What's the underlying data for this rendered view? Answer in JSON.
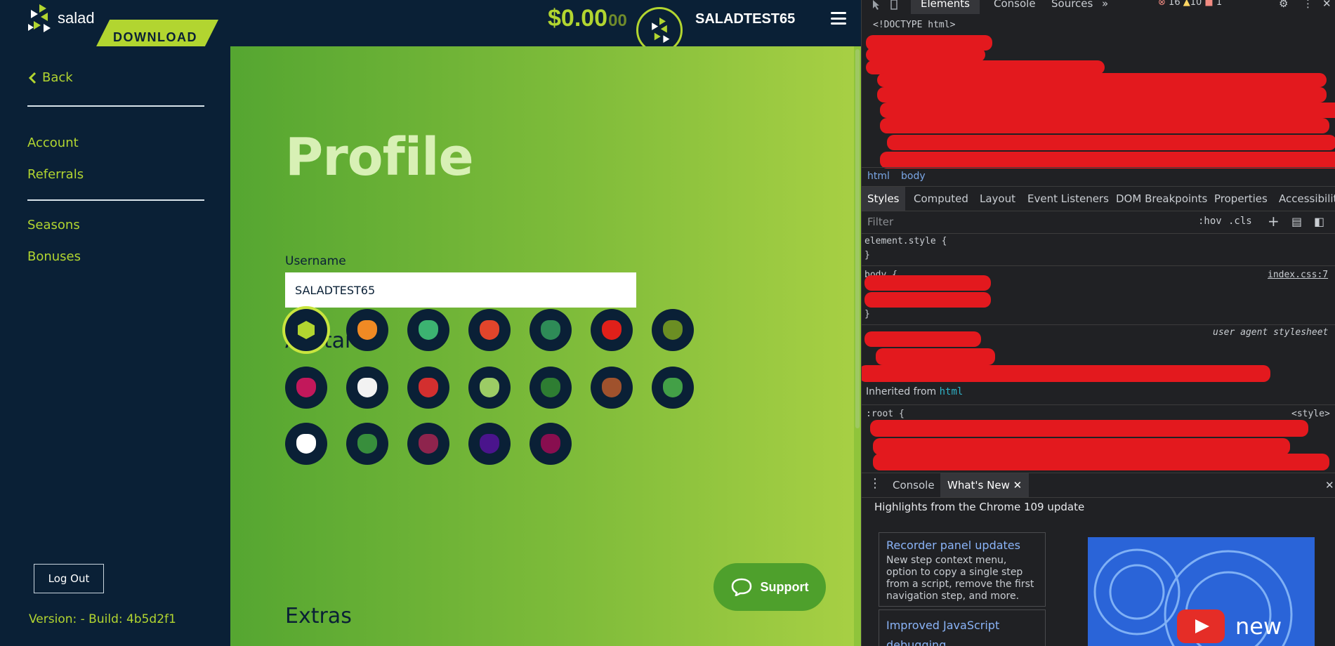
{
  "app": {
    "logo_text": "salad",
    "download_label": "DOWNLOAD",
    "balance_main": "$0.00",
    "balance_cents": "00",
    "username": "SALADTEST65"
  },
  "sidebar": {
    "back_label": "Back",
    "items": [
      {
        "label": "Account"
      },
      {
        "label": "Referrals"
      },
      {
        "label": "Seasons"
      },
      {
        "label": "Bonuses"
      }
    ],
    "logout_label": "Log Out",
    "version": "Version: - Build: 4b5d2f1"
  },
  "main": {
    "title": "Profile",
    "username_label": "Username",
    "username_value": "SALADTEST65",
    "avatar_title": "Avatar",
    "extras_title": "Extras",
    "support_label": "Support",
    "avatars": [
      {
        "name": "salad-logo",
        "selected": true
      },
      {
        "name": "carrot"
      },
      {
        "name": "green-pepper"
      },
      {
        "name": "tomato"
      },
      {
        "name": "kale"
      },
      {
        "name": "red-bell-pepper"
      },
      {
        "name": "avocado"
      },
      {
        "name": "radish"
      },
      {
        "name": "cauliflower"
      },
      {
        "name": "strawberry"
      },
      {
        "name": "lettuce"
      },
      {
        "name": "cucumbers"
      },
      {
        "name": "mushrooms"
      },
      {
        "name": "broccoli"
      },
      {
        "name": "eggs"
      },
      {
        "name": "herbs"
      },
      {
        "name": "beet"
      },
      {
        "name": "eggplant"
      },
      {
        "name": "onion"
      }
    ]
  },
  "devtools": {
    "tabs": [
      "Elements",
      "Console",
      "Sources"
    ],
    "errors": "16",
    "warnings": "10",
    "issues": "1",
    "doctype": "<!DOCTYPE html>",
    "breadcrumbs": [
      "html",
      "body"
    ],
    "style_tabs": [
      "Styles",
      "Computed",
      "Layout",
      "Event Listeners",
      "DOM Breakpoints",
      "Properties",
      "Accessibility"
    ],
    "filter_placeholder": "Filter",
    "hov": ":hov",
    "cls": ".cls",
    "element_style": "element.style {",
    "close_brace": "}",
    "body_rule": "body {",
    "body_source": "index.css:7",
    "ua_label": "user agent stylesheet",
    "inherited_from": "Inherited from",
    "inherited_el": "html",
    "root_rule": ":root {",
    "style_source": "<style>",
    "drawer_tabs": [
      "Console",
      "What's New"
    ],
    "highlights": "Highlights from the Chrome 109 update",
    "cards": [
      {
        "title": "Recorder panel updates",
        "body": "New step context menu, option to copy a single step from a script, remove the first navigation step, and more."
      },
      {
        "title": "Improved JavaScript debugging",
        "body": ""
      }
    ],
    "video_text": "new"
  },
  "colors": {
    "brand_lime": "#b2d530",
    "navy": "#0a2036",
    "devtools_bg": "#202124",
    "redaction": "#e3191e"
  }
}
